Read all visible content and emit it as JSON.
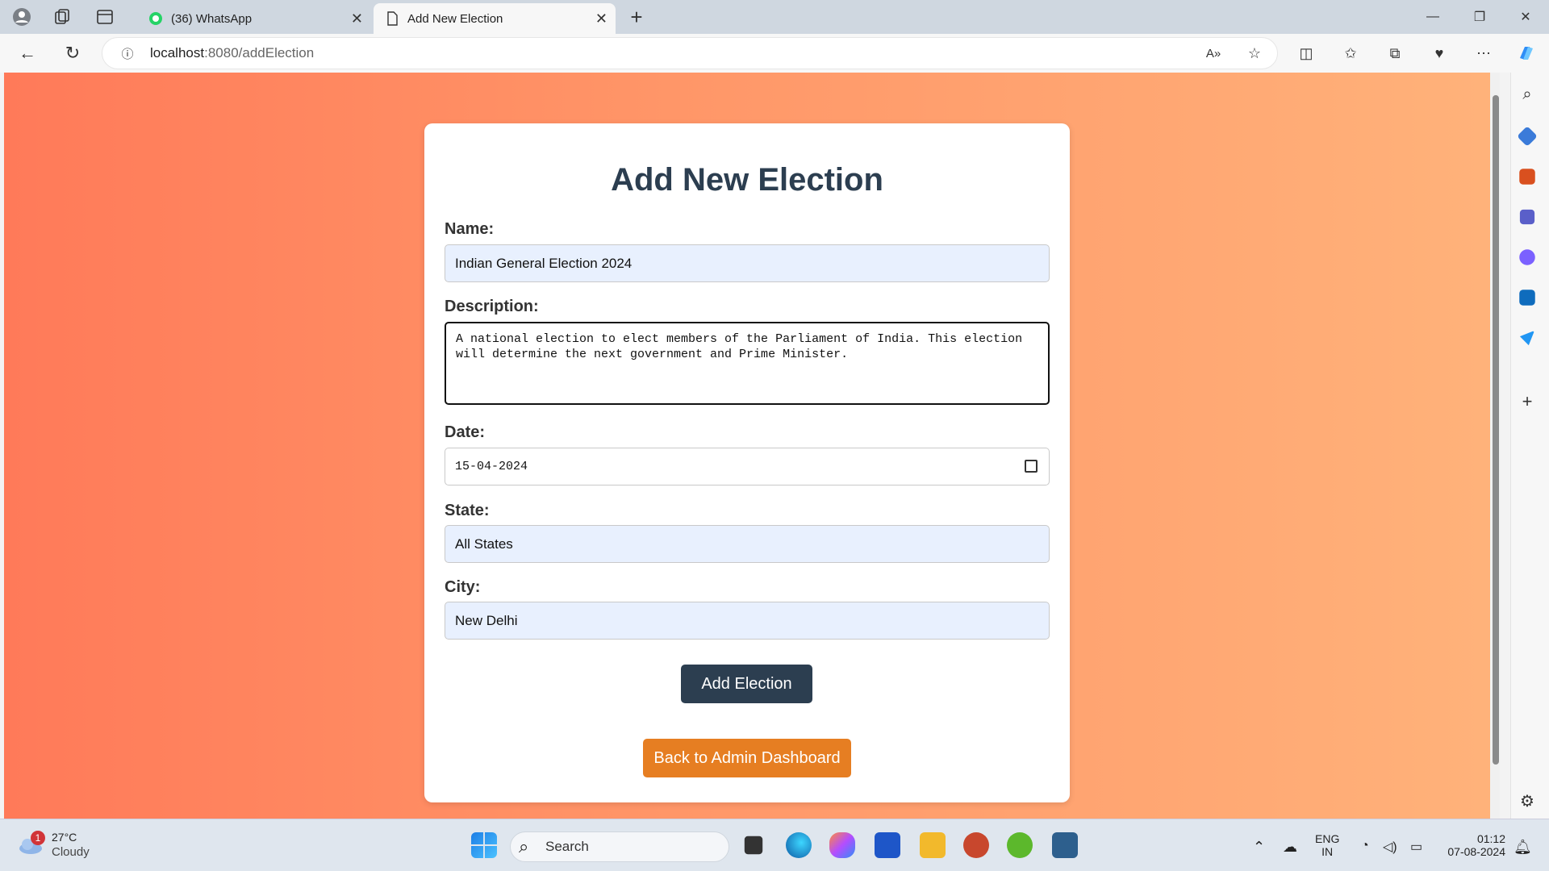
{
  "browser": {
    "tabs": [
      {
        "title": "(36) WhatsApp"
      },
      {
        "title": "Add New Election"
      }
    ],
    "url_host": "localhost",
    "url_path": ":8080/addElection"
  },
  "form": {
    "heading": "Add New Election",
    "name_label": "Name:",
    "name_value": "Indian General Election 2024",
    "description_label": "Description:",
    "description_value": "A national election to elect members of the Parliament of India. This election will determine the next government and Prime Minister.",
    "date_label": "Date:",
    "date_value": "15-04-2024",
    "state_label": "State:",
    "state_value": "All States",
    "city_label": "City:",
    "city_value": "New Delhi",
    "submit_label": "Add Election",
    "back_label": "Back to Admin Dashboard"
  },
  "taskbar": {
    "weather_temp": "27°C",
    "weather_desc": "Cloudy",
    "weather_badge": "1",
    "search_placeholder": "Search",
    "lang_line1": "ENG",
    "lang_line2": "IN",
    "time": "01:12",
    "date": "07-08-2024"
  },
  "colors": {
    "page_gradient_start": "#ff7a59",
    "page_gradient_end": "#ffb27a",
    "heading": "#2c3e50",
    "submit_button": "#2c3e50",
    "back_button": "#e67e22",
    "input_fill": "#e8f0fe"
  }
}
